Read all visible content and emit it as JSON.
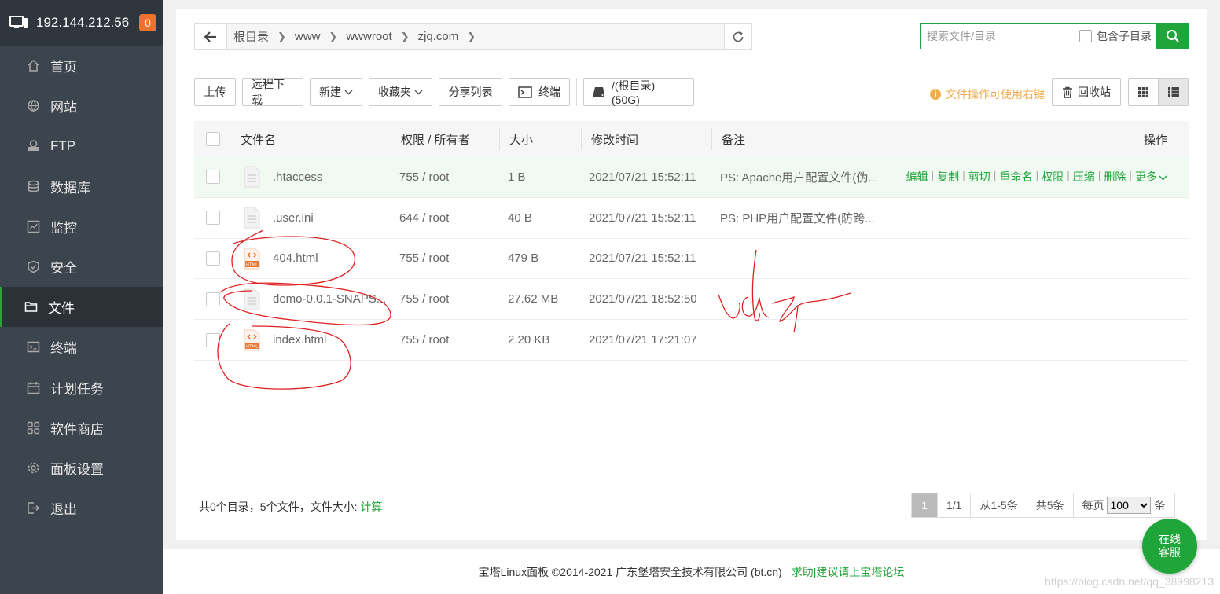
{
  "sidebar": {
    "ip": "192.144.212.56",
    "badge": "0",
    "items": [
      {
        "label": "首页",
        "icon": "home-icon"
      },
      {
        "label": "网站",
        "icon": "globe-icon"
      },
      {
        "label": "FTP",
        "icon": "ftp-icon"
      },
      {
        "label": "数据库",
        "icon": "database-icon"
      },
      {
        "label": "监控",
        "icon": "monitor-chart-icon"
      },
      {
        "label": "安全",
        "icon": "shield-icon"
      },
      {
        "label": "文件",
        "icon": "folder-icon",
        "active": true
      },
      {
        "label": "终端",
        "icon": "terminal-icon"
      },
      {
        "label": "计划任务",
        "icon": "calendar-icon"
      },
      {
        "label": "软件商店",
        "icon": "apps-grid-icon"
      },
      {
        "label": "面板设置",
        "icon": "gear-icon"
      },
      {
        "label": "退出",
        "icon": "logout-icon"
      }
    ]
  },
  "path": {
    "crumbs": [
      "根目录",
      "www",
      "wwwroot",
      "zjq.com"
    ]
  },
  "search": {
    "placeholder": "搜索文件/目录",
    "include_sub": "包含子目录"
  },
  "toolbar": {
    "upload": "上传",
    "remote_download": "远程下载",
    "new": "新建",
    "favorites": "收藏夹",
    "share_list": "分享列表",
    "terminal": "终端",
    "disk": "/(根目录) (50G)",
    "tip": "文件操作可使用右键",
    "recycle": "回收站"
  },
  "table": {
    "headers": {
      "name": "文件名",
      "perm": "权限 / 所有者",
      "size": "大小",
      "mtime": "修改时间",
      "note": "备注",
      "ops": "操作"
    },
    "rows": [
      {
        "name": ".htaccess",
        "perm": "755 / root",
        "size": "1 B",
        "mtime": "2021/07/21 15:52:11",
        "note": "PS: Apache用户配置文件(伪...",
        "type": "text"
      },
      {
        "name": ".user.ini",
        "perm": "644 / root",
        "size": "40 B",
        "mtime": "2021/07/21 15:52:11",
        "note": "PS: PHP用户配置文件(防跨...",
        "type": "text"
      },
      {
        "name": "404.html",
        "perm": "755 / root",
        "size": "479 B",
        "mtime": "2021/07/21 15:52:11",
        "note": "",
        "type": "html"
      },
      {
        "name": "demo-0.0.1-SNAPS...",
        "perm": "755 / root",
        "size": "27.62 MB",
        "mtime": "2021/07/21 18:52:50",
        "note": "",
        "type": "text"
      },
      {
        "name": "index.html",
        "perm": "755 / root",
        "size": "2.20 KB",
        "mtime": "2021/07/21 17:21:07",
        "note": "",
        "type": "html"
      }
    ],
    "row_actions": [
      "编辑",
      "复制",
      "剪切",
      "重命名",
      "权限",
      "压缩",
      "删除",
      "更多"
    ]
  },
  "summary": {
    "text": "共0个目录，5个文件，文件大小: ",
    "calc": "计算"
  },
  "pager": {
    "current": "1",
    "pages": "1/1",
    "range": "从1-5条",
    "total": "共5条",
    "per_page_label": "每页",
    "per_page": "100",
    "unit": "条"
  },
  "footer": {
    "copyright": "宝塔Linux面板 ©2014-2021 广东堡塔安全技术有限公司 (bt.cn)",
    "help": "求助|建议请上宝塔论坛",
    "watermark": "https://blog.csdn.net/qq_38998213"
  },
  "chat": {
    "line1": "在线",
    "line2": "客服"
  },
  "colors": {
    "accent": "#20a53a",
    "sidebar": "#3c444d",
    "warning": "#f0ad4e",
    "annotation": "#e02020"
  }
}
